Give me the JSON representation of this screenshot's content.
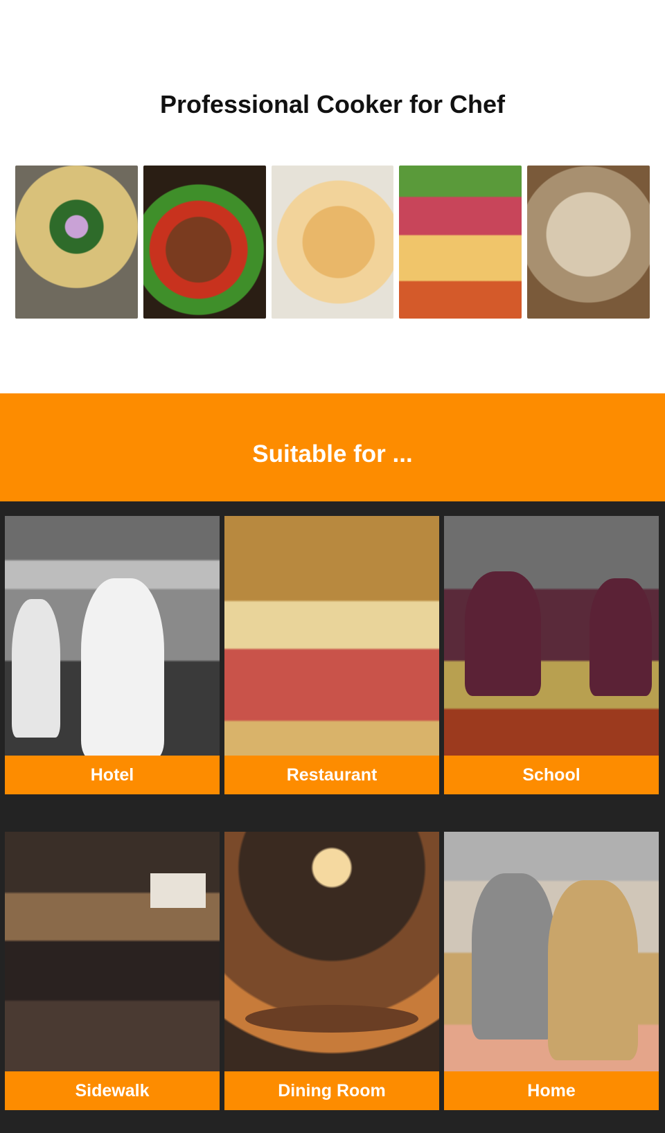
{
  "header": {
    "title": "Professional Cooker for Chef"
  },
  "food_images": [
    {
      "alt": "oysters-dish"
    },
    {
      "alt": "stir-fry-dish"
    },
    {
      "alt": "fried-shrimp-dish"
    },
    {
      "alt": "hotpot-ingredients"
    },
    {
      "alt": "stewed-meat-dish"
    }
  ],
  "suitable": {
    "title": "Suitable for ...",
    "items": [
      {
        "label": "Hotel"
      },
      {
        "label": "Restaurant"
      },
      {
        "label": "School"
      },
      {
        "label": "Sidewalk"
      },
      {
        "label": "Dining Room"
      },
      {
        "label": "Home"
      }
    ]
  },
  "colors": {
    "accent_orange": "#fd8c00",
    "dark_background": "#232323",
    "title_text": "#111111",
    "label_text": "#ffffff"
  }
}
